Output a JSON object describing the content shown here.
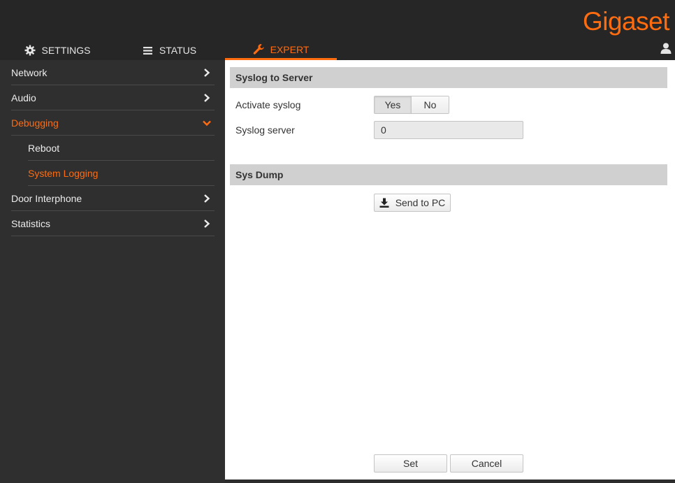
{
  "brand": {
    "logo_text": "Gigaset",
    "accent": "#ff6c0f"
  },
  "tabs": [
    {
      "label": "SETTINGS",
      "icon": "gear-icon"
    },
    {
      "label": "STATUS",
      "icon": "list-icon"
    },
    {
      "label": "EXPERT",
      "icon": "wrench-icon",
      "active": true
    }
  ],
  "sidebar": {
    "items": [
      {
        "label": "Network",
        "icon": "chevron-right-icon"
      },
      {
        "label": "Audio",
        "icon": "chevron-right-icon"
      },
      {
        "label": "Debugging",
        "icon": "chevron-down-icon",
        "expanded": true
      },
      {
        "label": "Reboot"
      },
      {
        "label": "System Logging",
        "selected": true
      },
      {
        "label": "Door Interphone",
        "icon": "chevron-right-icon"
      },
      {
        "label": "Statistics",
        "icon": "chevron-right-icon"
      }
    ]
  },
  "syslog": {
    "title": "Syslog to Server",
    "activate_label": "Activate syslog",
    "yes_label": "Yes",
    "no_label": "No",
    "selected": "Yes",
    "server_label": "Syslog server",
    "server_value": "0"
  },
  "sysdump": {
    "title": "Sys Dump",
    "send_label": "Send to PC"
  },
  "footer": {
    "set_label": "Set",
    "cancel_label": "Cancel"
  }
}
